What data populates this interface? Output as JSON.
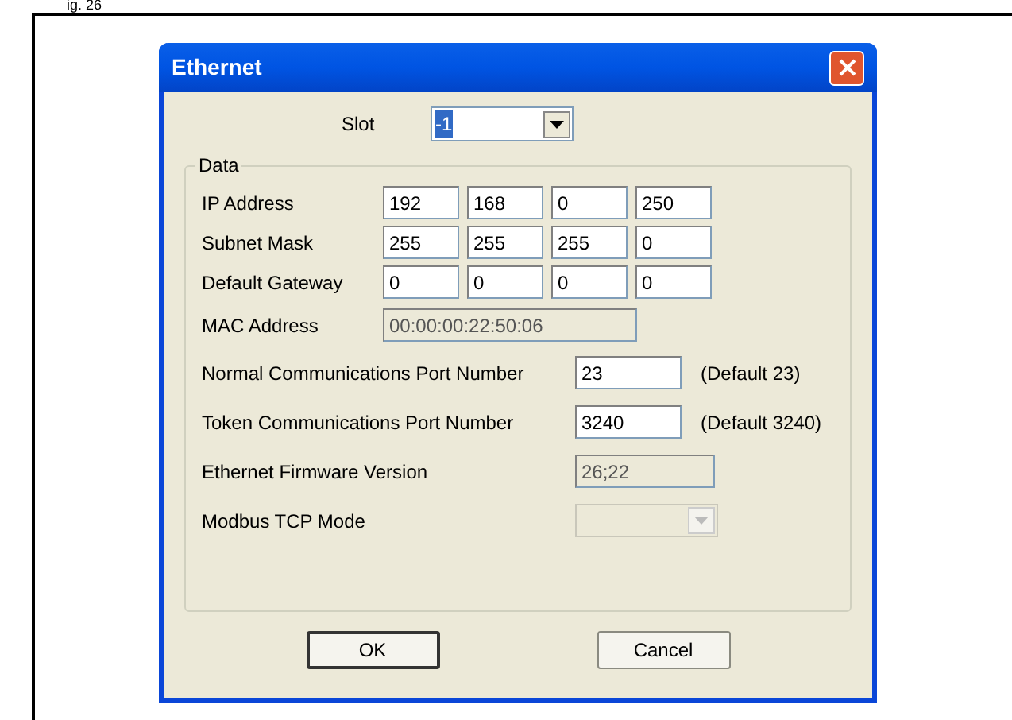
{
  "caption": "ig. 26",
  "window": {
    "title": "Ethernet"
  },
  "slot": {
    "label": "Slot",
    "value": "-1",
    "value_selected": true
  },
  "group": {
    "title": "Data",
    "rows": [
      {
        "kind": "octets",
        "label": "IP Address",
        "values": [
          "192",
          "168",
          "0",
          "250"
        ]
      },
      {
        "kind": "octets",
        "label": "Subnet Mask",
        "values": [
          "255",
          "255",
          "255",
          "0"
        ]
      },
      {
        "kind": "octets",
        "label": "Default Gateway",
        "values": [
          "0",
          "0",
          "0",
          "0"
        ]
      },
      {
        "kind": "wide",
        "label": "MAC Address",
        "value": "00:00:00:22:50:06",
        "disabled": true
      },
      {
        "kind": "port",
        "label": "Normal Communications Port Number",
        "value": "23",
        "note": "(Default 23)",
        "disabled": false
      },
      {
        "kind": "port",
        "label": "Token Communications Port Number",
        "value": "3240",
        "note": "(Default 3240)",
        "disabled": false
      },
      {
        "kind": "port",
        "label": "Ethernet Firmware Version",
        "value": "26;22",
        "disabled": true
      },
      {
        "kind": "dropdown",
        "label": "Modbus TCP Mode",
        "disabled": true
      }
    ]
  },
  "buttons": [
    {
      "label": "OK",
      "default": true
    },
    {
      "label": "Cancel",
      "default": false
    }
  ]
}
